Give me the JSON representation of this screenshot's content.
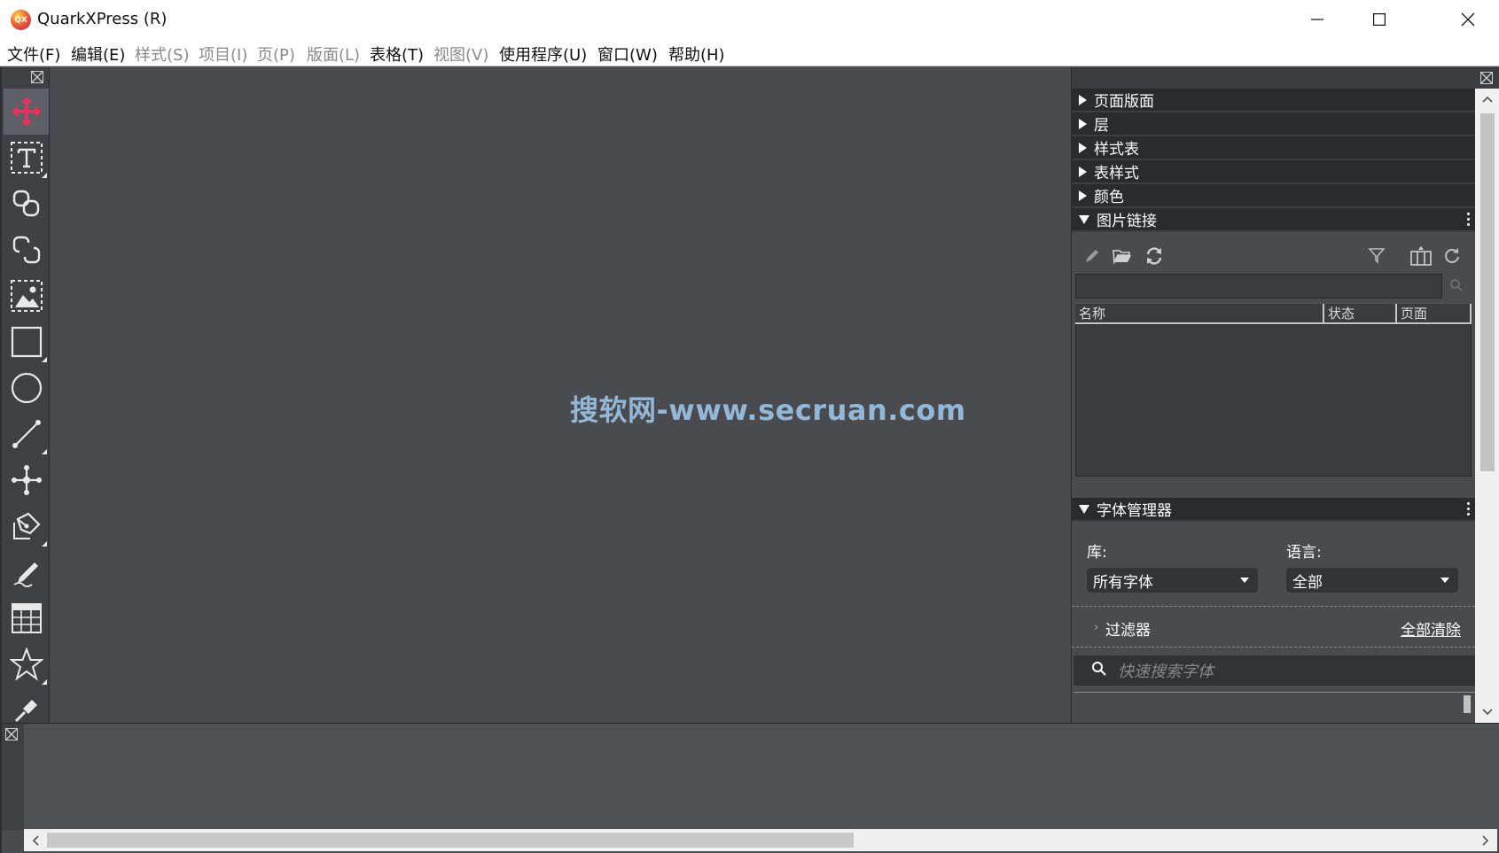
{
  "window": {
    "title": "QuarkXPress (R)",
    "logo_text": "QX",
    "controls": [
      "minimize-icon",
      "maximize-icon",
      "close-icon"
    ]
  },
  "menubar": {
    "items": [
      {
        "label": "文件(F)",
        "enabled": true
      },
      {
        "label": "编辑(E)",
        "enabled": true
      },
      {
        "label": "样式(S)",
        "enabled": false
      },
      {
        "label": "项目(I)",
        "enabled": false
      },
      {
        "label": "页(P)",
        "enabled": false
      },
      {
        "label": "版面(L)",
        "enabled": false
      },
      {
        "label": "表格(T)",
        "enabled": true
      },
      {
        "label": "视图(V)",
        "enabled": false
      },
      {
        "label": "使用程序(U)",
        "enabled": true
      },
      {
        "label": "窗口(W)",
        "enabled": true
      },
      {
        "label": "帮助(H)",
        "enabled": true
      }
    ]
  },
  "toolbox": {
    "tools": [
      {
        "icon": "move-icon",
        "active": true
      },
      {
        "icon": "text-content-icon",
        "active": false
      },
      {
        "icon": "text-linking-icon",
        "active": false
      },
      {
        "icon": "text-unlinking-icon",
        "active": false
      },
      {
        "icon": "picture-content-icon",
        "active": false
      },
      {
        "icon": "rectangle-box-icon",
        "active": false
      },
      {
        "icon": "oval-box-icon",
        "active": false
      },
      {
        "icon": "line-icon",
        "active": false
      },
      {
        "icon": "bezier-point-icon",
        "active": false
      },
      {
        "icon": "bezier-pen-icon",
        "active": false
      },
      {
        "icon": "freehand-pencil-icon",
        "active": false
      },
      {
        "icon": "table-icon",
        "active": false
      },
      {
        "icon": "star-icon",
        "active": false
      },
      {
        "icon": "eyedropper-icon",
        "active": false
      }
    ]
  },
  "canvas": {
    "watermark": "搜软网-www.secruan.com"
  },
  "right_panel": {
    "collapsed_sections": [
      "页面版面",
      "层",
      "样式表",
      "表样式",
      "颜色"
    ],
    "picture_links": {
      "title": "图片链接",
      "toolbar_icons": [
        "edit-pencil-icon",
        "open-folder-icon",
        "relink-icon",
        "filter-icon",
        "columns-icon",
        "refresh-icon"
      ],
      "search_value": "",
      "columns": [
        "名称",
        "状态",
        "页面"
      ]
    },
    "font_manager": {
      "title": "字体管理器",
      "library_label": "库:",
      "library_value": "所有字体",
      "language_label": "语言:",
      "language_value": "全部",
      "filter_label": "过滤器",
      "clear_all": "全部清除",
      "search_placeholder": "快速搜索字体"
    }
  },
  "colors": {
    "canvas": "#4a4b4f",
    "panel_header": "#2a2b2d",
    "accent_move_tool": "#e8305a",
    "watermark": "#93b7d6"
  }
}
